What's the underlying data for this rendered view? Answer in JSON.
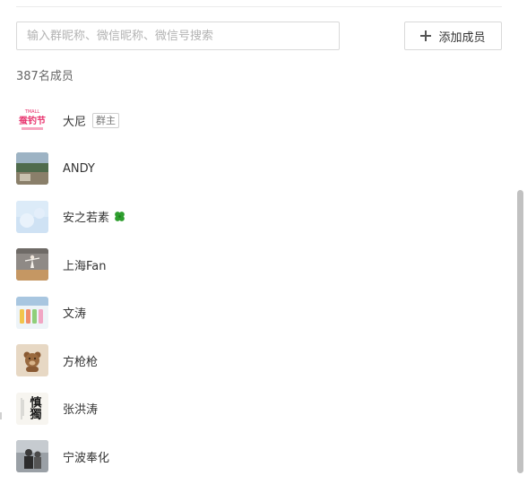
{
  "search": {
    "placeholder": "输入群昵称、微信昵称、微信号搜索",
    "value": ""
  },
  "toolbar": {
    "add_member_label": "添加成员"
  },
  "member_count_label": "387名成员",
  "members": [
    {
      "name": "大尼",
      "badge": "群主",
      "avatar": "tmall-logo-avatar"
    },
    {
      "name": "ANDY",
      "avatar": "photo-avatar"
    },
    {
      "name": "安之若素",
      "emoji": "clover-icon",
      "avatar": "sky-avatar"
    },
    {
      "name": "上海Fan",
      "avatar": "dancer-avatar"
    },
    {
      "name": "文涛",
      "avatar": "bottles-avatar"
    },
    {
      "name": "方枪枪",
      "avatar": "teddy-bear-avatar"
    },
    {
      "name": "张洪涛",
      "avatar": "calligraphy-avatar"
    },
    {
      "name": "宁波奉化",
      "avatar": "person-avatar"
    }
  ],
  "avatar_texts": {
    "tmall_top": "TMALL",
    "tmall_main": "蚕钓节",
    "calligraphy": "慎獨"
  },
  "colors": {
    "border": "#d9d9d9",
    "text": "#333333",
    "muted": "#666666",
    "placeholder": "#b3b3b3",
    "scrollbar": "#c1c1c1",
    "clover": "#2e9e2e",
    "tmall_pink": "#e8336e"
  }
}
